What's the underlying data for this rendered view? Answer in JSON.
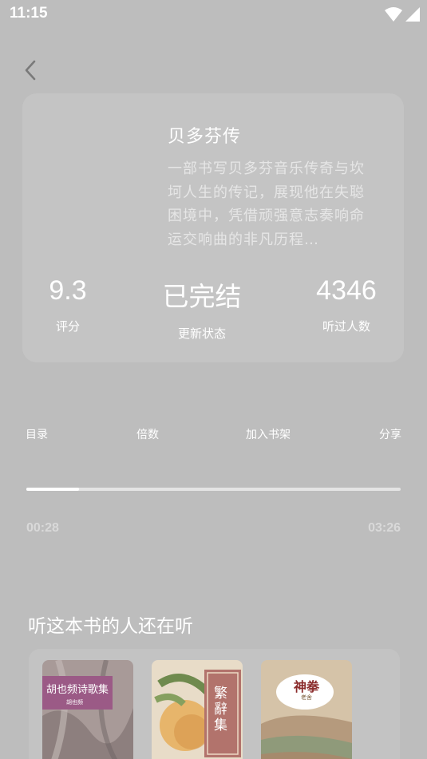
{
  "status_bar": {
    "time": "11:15"
  },
  "book": {
    "title": "贝多芬传",
    "description": "一部书写贝多芬音乐传奇与坎坷人生的传记，展现他在失聪困境中，凭借顽强意志奏响命运交响曲的非凡历程…"
  },
  "stats": [
    {
      "value": "9.3",
      "label": "评分"
    },
    {
      "value": "已完结",
      "label": "更新状态"
    },
    {
      "value": "4346",
      "label": "听过人数"
    }
  ],
  "controls": {
    "catalog": "目录",
    "speed": "倍数",
    "add_shelf": "加入书架",
    "share": "分享"
  },
  "player": {
    "current_time": "00:28",
    "total_time": "03:26",
    "progress": 0.14
  },
  "recommend": {
    "title": "听这本书的人还在听",
    "items": [
      {
        "cover_title": "胡也频诗歌集",
        "cover_author": "胡也频",
        "color": "#9b5a86"
      },
      {
        "cover_title": "繁辭集",
        "cover_author": "",
        "color": "#b2736c"
      },
      {
        "cover_title": "神拳",
        "cover_author": "老舍",
        "color": "#c6a48a"
      }
    ]
  }
}
